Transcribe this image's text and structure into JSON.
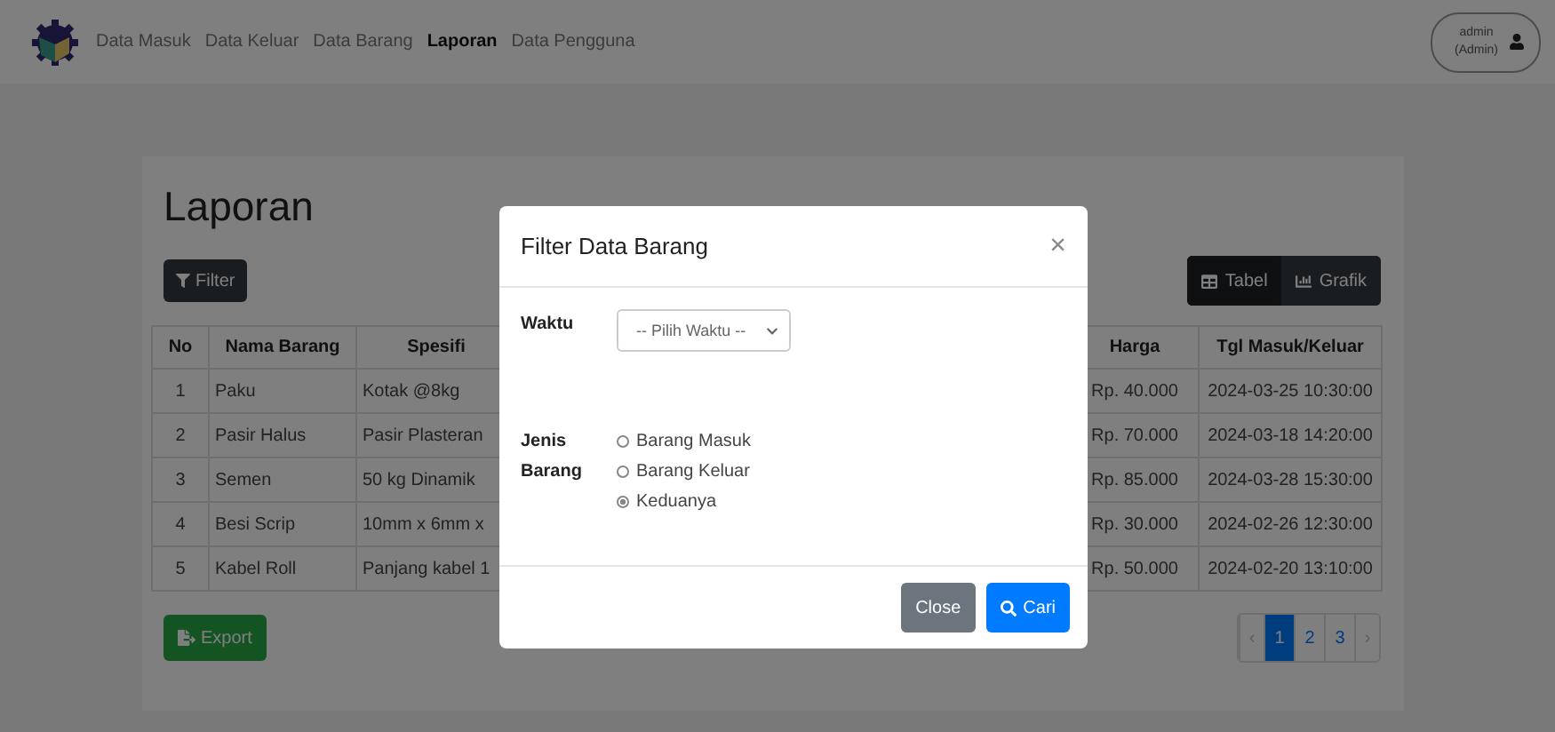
{
  "navbar": {
    "links": [
      {
        "label": "Data Masuk",
        "selected": false
      },
      {
        "label": "Data Keluar",
        "selected": false
      },
      {
        "label": "Data Barang",
        "selected": false
      },
      {
        "label": "Laporan",
        "selected": true
      },
      {
        "label": "Data Pengguna",
        "selected": false
      }
    ],
    "user": {
      "name": "admin",
      "role": "(Admin)"
    }
  },
  "page": {
    "title": "Laporan",
    "filter_button": "Filter",
    "view_toggle": [
      {
        "label": "Tabel",
        "selected": true
      },
      {
        "label": "Grafik",
        "selected": false
      }
    ],
    "table": {
      "columns": [
        "No",
        "Nama Barang",
        "Spesifi",
        "Harga",
        "Tgl Masuk/Keluar"
      ],
      "rows": [
        [
          "1",
          "Paku",
          "Kotak @8kg",
          "Rp. 40.000",
          "2024-03-25 10:30:00"
        ],
        [
          "2",
          "Pasir Halus",
          "Pasir Plasteran",
          "Rp. 70.000",
          "2024-03-18 14:20:00"
        ],
        [
          "3",
          "Semen",
          "50 kg Dinamik",
          "Rp. 85.000",
          "2024-03-28 15:30:00"
        ],
        [
          "4",
          "Besi Scrip",
          "10mm x 6mm x",
          "Rp. 30.000",
          "2024-02-26 12:30:00"
        ],
        [
          "5",
          "Kabel Roll",
          "Panjang kabel 1",
          "Rp. 50.000",
          "2024-02-20 13:10:00"
        ]
      ]
    },
    "export_button": "Export",
    "pagination": [
      {
        "label": "‹",
        "kind": "arrow",
        "selected": false
      },
      {
        "label": "1",
        "kind": "page",
        "selected": true
      },
      {
        "label": "2",
        "kind": "page",
        "selected": false
      },
      {
        "label": "3",
        "kind": "page",
        "selected": false
      },
      {
        "label": "›",
        "kind": "arrow",
        "selected": false
      }
    ]
  },
  "modal": {
    "title": "Filter Data Barang",
    "close": "×",
    "waktu": {
      "label": "Waktu",
      "placeholder": "-- Pilih Waktu --"
    },
    "jenis": {
      "label": "Jenis Barang",
      "options": [
        {
          "label": "Barang Masuk",
          "selected": false
        },
        {
          "label": "Barang Keluar",
          "selected": false
        },
        {
          "label": "Keduanya",
          "selected": true
        }
      ]
    },
    "buttons": [
      {
        "label": "Close",
        "kind": "secondary"
      },
      {
        "label": "Cari",
        "kind": "primary"
      }
    ]
  }
}
